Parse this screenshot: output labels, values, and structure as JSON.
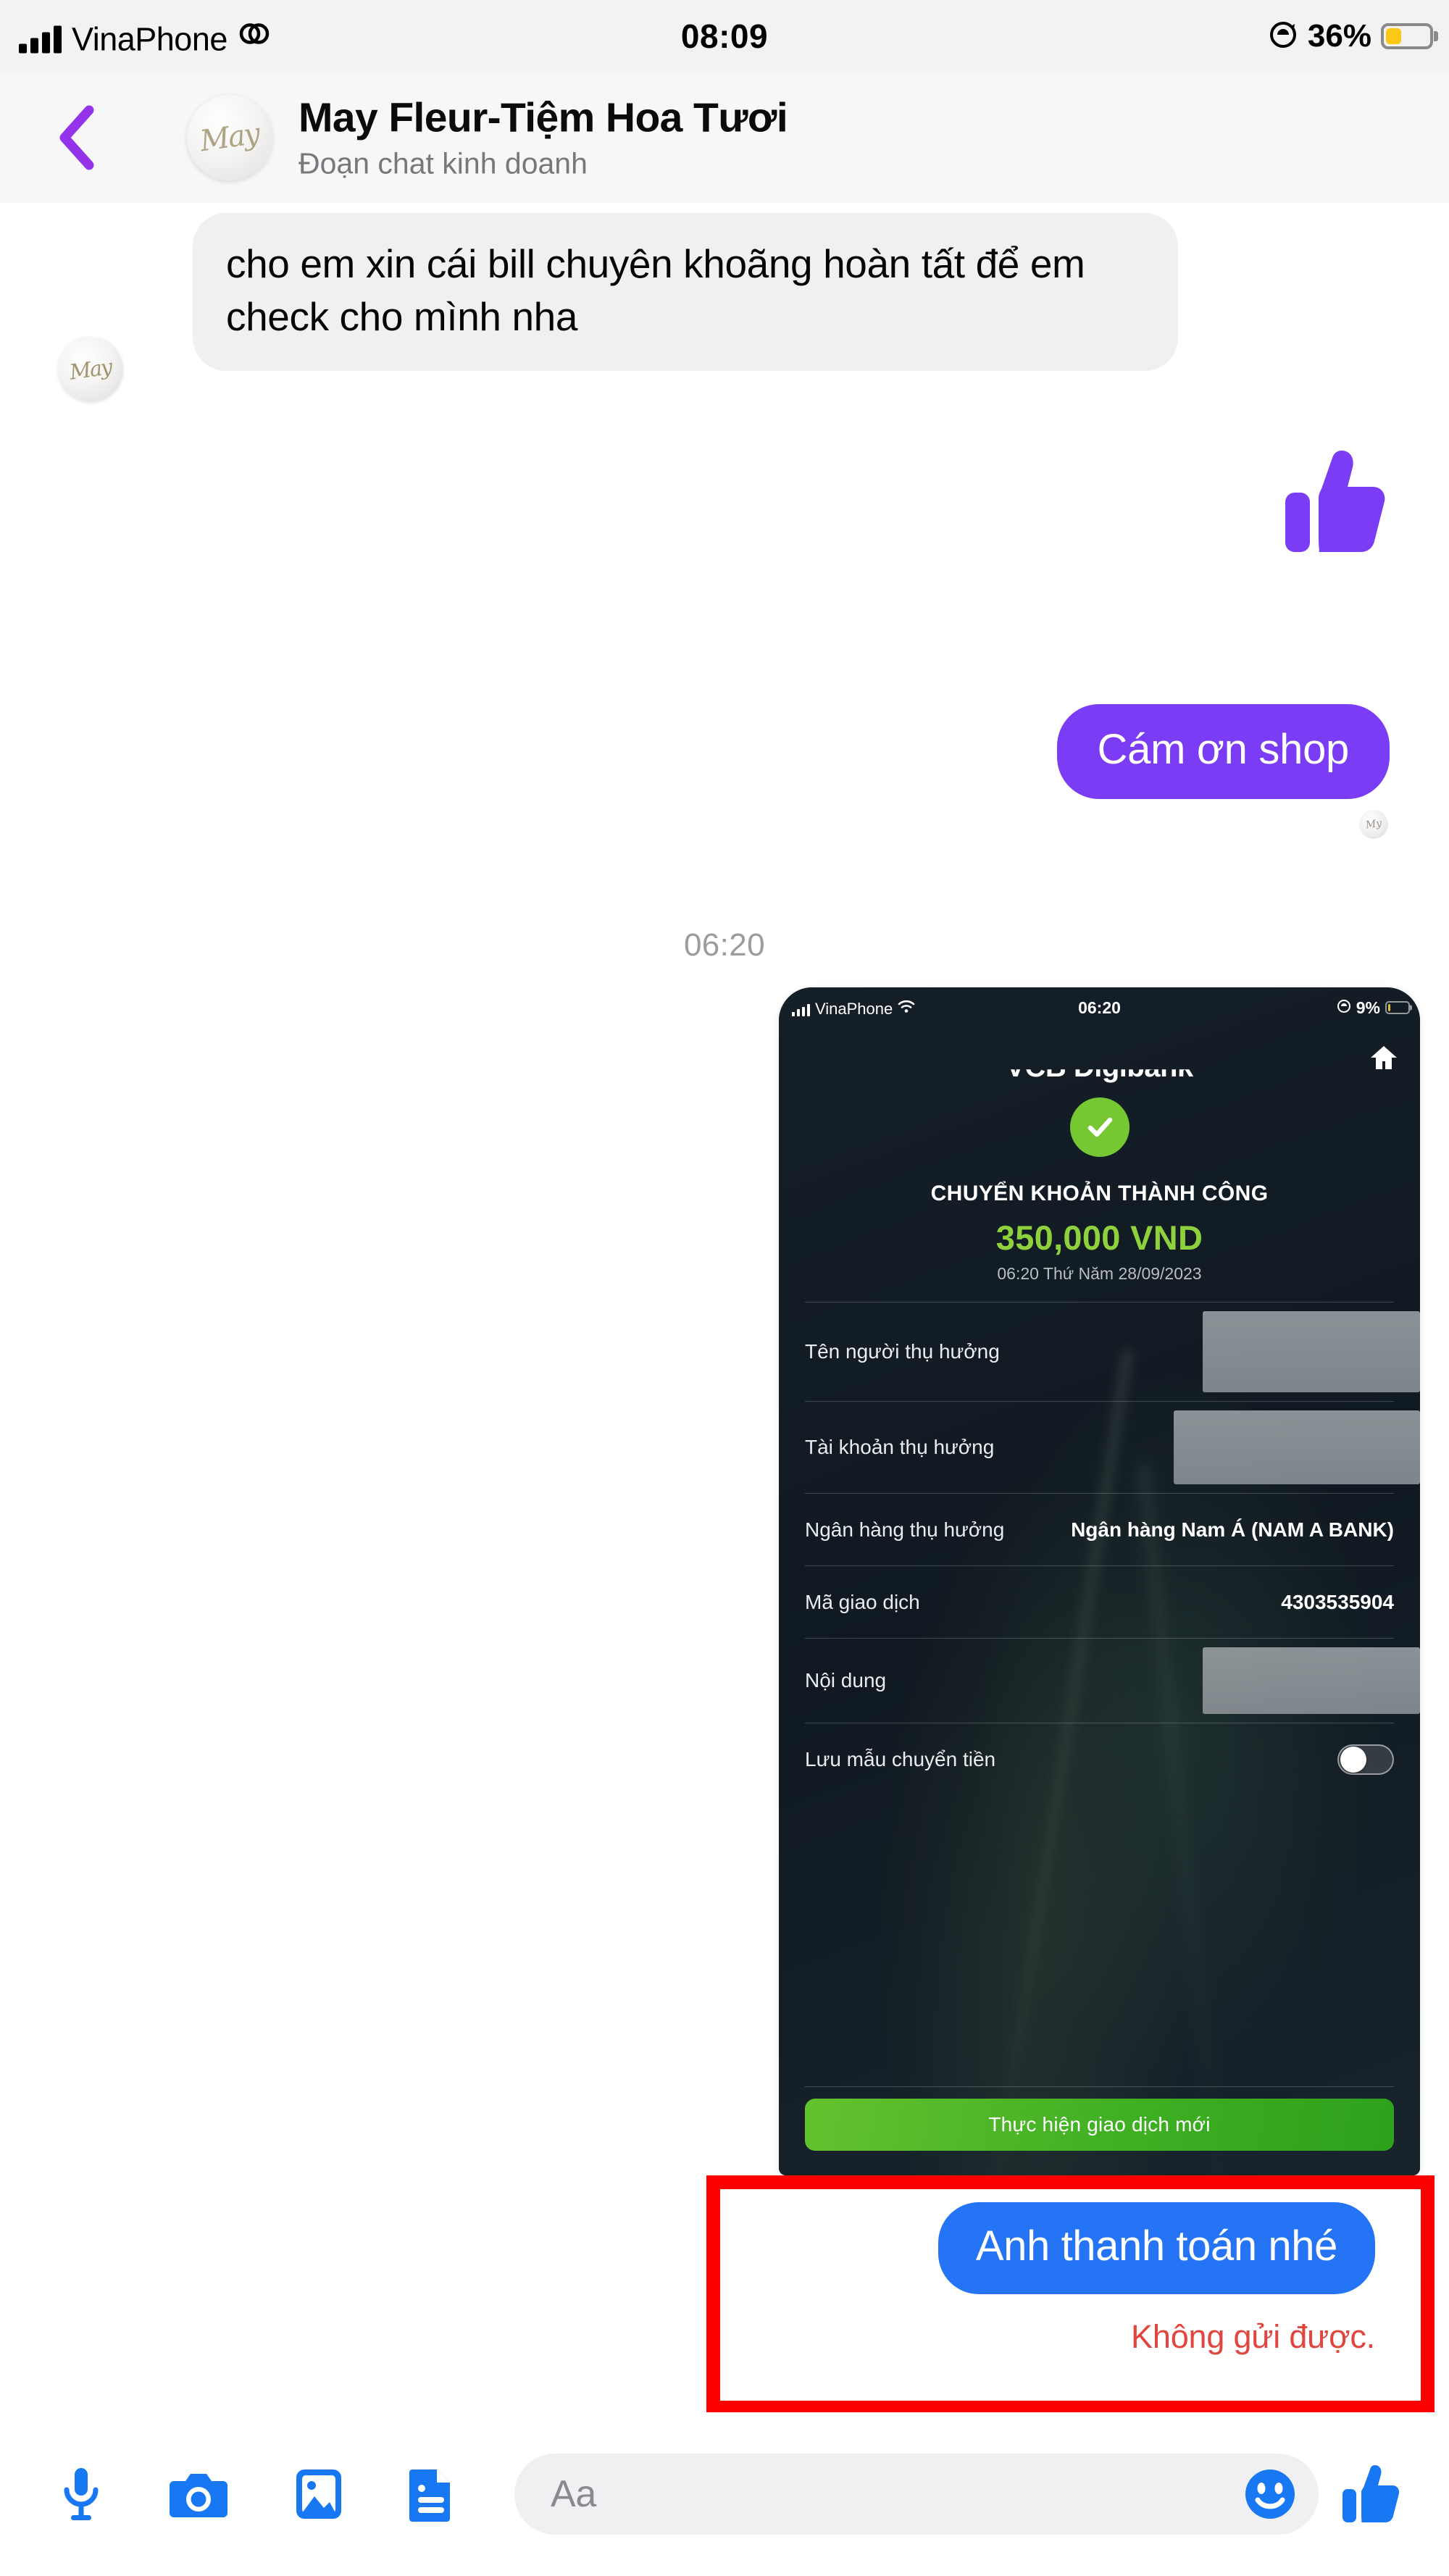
{
  "status_bar": {
    "carrier": "VinaPhone",
    "time": "08:09",
    "battery_percent": "36%",
    "battery_level": 36,
    "signal_icon": "signal-bars-icon",
    "link_icon": "link-icon",
    "lock_rotation_icon": "rotation-lock-icon",
    "battery_color": "#fcc816"
  },
  "header": {
    "back_icon": "back-chevron-icon",
    "back_color": "#9333ea",
    "avatar_monogram": "May",
    "title": "May Fleur-Tiệm Hoa Tươi",
    "subtitle": "Đoạn chat kinh doanh"
  },
  "thread": {
    "incoming_message": {
      "text": "cho em xin cái bill chuyên khoãng hoàn tất để em check cho mình nha",
      "avatar_monogram": "May",
      "bubble_color": "#f0f0f0"
    },
    "sticker": {
      "name": "thumbs-up-sticker",
      "color": "#7a3df5"
    },
    "outgoing_message": {
      "text": "Cám ơn shop",
      "bubble_color": "#7a3df5",
      "seen_avatar_monogram": "My"
    },
    "timestamp_divider": "06:20"
  },
  "attachment": {
    "status_bar": {
      "carrier": "VinaPhone",
      "wifi_icon": "wifi-icon",
      "time": "06:20",
      "battery_percent": "9%",
      "battery_level": 9
    },
    "home_icon": "home-icon",
    "brand": "VCB Digibank",
    "check_icon": "success-check-icon",
    "check_color": "#76c832",
    "success_title": "CHUYỂN KHOẢN THÀNH CÔNG",
    "amount": "350,000 VND",
    "amount_color": "#8ed13c",
    "datetime": "06:20 Thứ Năm 28/09/2023",
    "rows": [
      {
        "label": "Tên người thụ hưởng",
        "value": "",
        "redacted": true
      },
      {
        "label": "Tài khoản thụ hưởng",
        "value": "",
        "redacted": true
      },
      {
        "label": "Ngân hàng thụ hưởng",
        "value": "Ngân hàng  Nam Á (NAM A BANK)",
        "redacted": false
      },
      {
        "label": "Mã giao dịch",
        "value": "4303535904",
        "redacted": false
      },
      {
        "label": "Nội dung",
        "value": "",
        "redacted": true
      }
    ],
    "toggle_row": {
      "label": "Lưu mẫu chuyển tiền",
      "state": "off"
    },
    "cta_label": "Thực hiện giao dịch mới",
    "cta_color": "#3faf23"
  },
  "failed_message": {
    "text": "Anh thanh toán nhé",
    "bubble_color": "#2574f5",
    "error": "Không gửi được.",
    "error_color": "#e2453e",
    "annotation_color": "#fb0000"
  },
  "composer": {
    "icons": [
      {
        "name": "microphone-icon"
      },
      {
        "name": "camera-icon"
      },
      {
        "name": "gallery-icon"
      },
      {
        "name": "document-icon"
      }
    ],
    "input_placeholder": "Aa",
    "input_value": "",
    "emoji_icon": "emoji-smiley-icon",
    "like_icon": "thumbs-up-icon",
    "icon_color": "#1877f2"
  }
}
